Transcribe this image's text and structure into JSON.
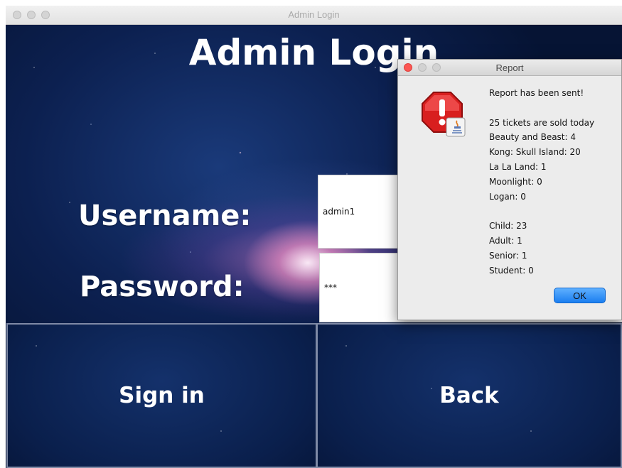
{
  "window": {
    "title": "Admin Login"
  },
  "login": {
    "heading": "Admin Login",
    "username_label": "Username:",
    "username_value": "admin1",
    "password_label": "Password:",
    "password_value": "***",
    "sign_in_label": "Sign in",
    "back_label": "Back"
  },
  "dialog": {
    "title": "Report",
    "icon": "java-warning-icon",
    "lines": [
      "Report has been sent!",
      "",
      "25 tickets are sold today",
      "Beauty and Beast: 4",
      "Kong: Skull Island: 20",
      "La La Land: 1",
      "Moonlight: 0",
      "Logan: 0",
      "",
      "Child: 23",
      "Adult: 1",
      "Senior: 1",
      "Student: 0"
    ],
    "ok_label": "OK"
  },
  "colors": {
    "accent": "#1a7ef0",
    "close_dot": "#fc5753",
    "space_dark": "#061434"
  }
}
